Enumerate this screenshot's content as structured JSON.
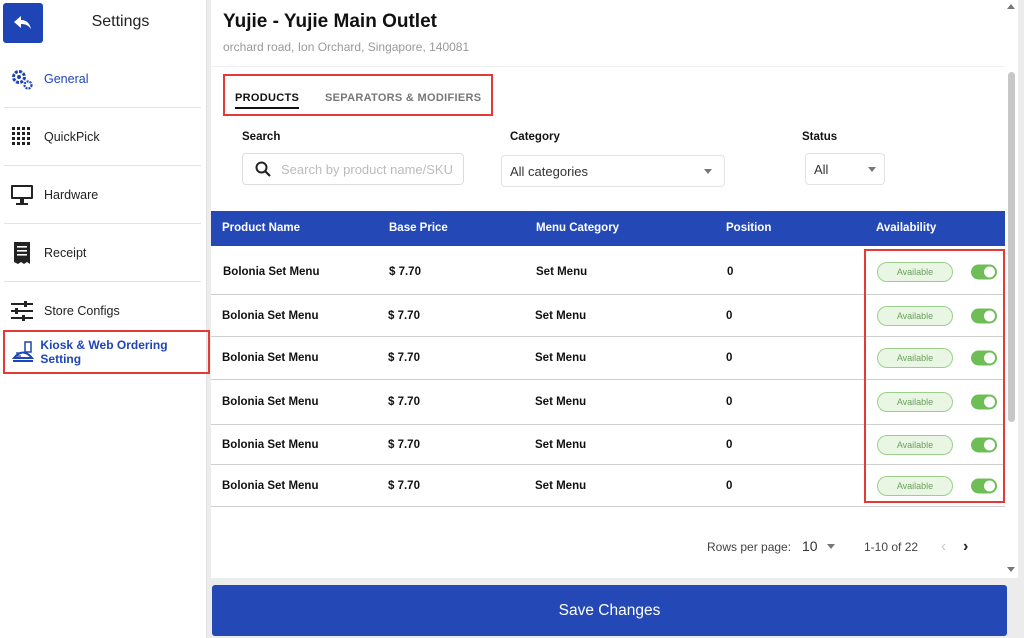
{
  "sidebar": {
    "title": "Settings",
    "items": [
      {
        "label": "General",
        "icon": "gear-icon"
      },
      {
        "label": "QuickPick",
        "icon": "grid-icon"
      },
      {
        "label": "Hardware",
        "icon": "monitor-icon"
      },
      {
        "label": "Receipt",
        "icon": "receipt-icon"
      },
      {
        "label": "Store Configs",
        "icon": "sliders-icon"
      },
      {
        "label": "Kiosk & Web Ordering Setting",
        "icon": "kiosk-icon"
      }
    ]
  },
  "store": {
    "name": "Yujie - Yujie Main Outlet",
    "address": "orchard road, Ion Orchard, Singapore, 140081"
  },
  "tabs": {
    "products": "PRODUCTS",
    "modifiers": "SEPARATORS & MODIFIERS"
  },
  "filters": {
    "search_label": "Search",
    "search_placeholder": "Search by product name/SKU",
    "category_label": "Category",
    "category_value": "All categories",
    "status_label": "Status",
    "status_value": "All"
  },
  "table": {
    "headers": {
      "name": "Product Name",
      "price": "Base Price",
      "category": "Menu Category",
      "position": "Position",
      "availability": "Availability"
    },
    "rows": [
      {
        "name": "Bolonia Set Menu",
        "price": "$ 7.70",
        "category": "Set Menu",
        "position": "0",
        "status": "Available"
      },
      {
        "name": "Bolonia Set Menu",
        "price": "$ 7.70",
        "category": "Set Menu",
        "position": "0",
        "status": "Available"
      },
      {
        "name": "Bolonia Set Menu",
        "price": "$ 7.70",
        "category": "Set Menu",
        "position": "0",
        "status": "Available"
      },
      {
        "name": "Bolonia Set Menu",
        "price": "$ 7.70",
        "category": "Set Menu",
        "position": "0",
        "status": "Available"
      },
      {
        "name": "Bolonia Set Menu",
        "price": "$ 7.70",
        "category": "Set Menu",
        "position": "0",
        "status": "Available"
      },
      {
        "name": "Bolonia Set Menu",
        "price": "$ 7.70",
        "category": "Set Menu",
        "position": "0",
        "status": "Available"
      }
    ]
  },
  "pagination": {
    "rows_label": "Rows per page:",
    "rows_value": "10",
    "range": "1-10 of 22"
  },
  "save_label": "Save Changes",
  "colors": {
    "primary": "#2449b6",
    "highlight": "#e53935",
    "toggle_on": "#6fbd57"
  }
}
